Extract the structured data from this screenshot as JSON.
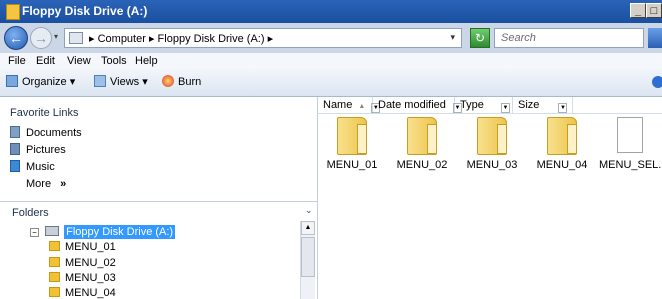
{
  "window": {
    "title": "Floppy Disk Drive (A:)",
    "min_label": "_",
    "max_label": "□"
  },
  "address": {
    "crumbs": [
      "Computer",
      "Floppy Disk Drive (A:)"
    ],
    "separator": "▸",
    "search_placeholder": "Search"
  },
  "menu": {
    "items": [
      "File",
      "Edit",
      "View",
      "Tools",
      "Help"
    ]
  },
  "toolbar": {
    "organize": "Organize",
    "views": "Views",
    "burn": "Burn",
    "dropdown_glyph": "▾"
  },
  "nav": {
    "favorites_heading": "Favorite Links",
    "favorites": [
      "Documents",
      "Pictures",
      "Music"
    ],
    "more_label": "More",
    "more_glyph": "»",
    "folders_heading": "Folders",
    "tree_root": "Floppy Disk Drive (A:)",
    "tree_children": [
      "MENU_01",
      "MENU_02",
      "MENU_03",
      "MENU_04"
    ]
  },
  "content": {
    "columns": [
      "Name",
      "Date modified",
      "Type",
      "Size"
    ],
    "items": [
      {
        "name": "MENU_01",
        "type": "folder"
      },
      {
        "name": "MENU_02",
        "type": "folder"
      },
      {
        "name": "MENU_03",
        "type": "folder"
      },
      {
        "name": "MENU_04",
        "type": "folder"
      },
      {
        "name": "MENU_SEL....",
        "type": "file"
      }
    ]
  },
  "colors": {
    "titlebar": "#1b4f9f",
    "address_bg": "#cbd7e6",
    "selection": "#3399ff"
  }
}
